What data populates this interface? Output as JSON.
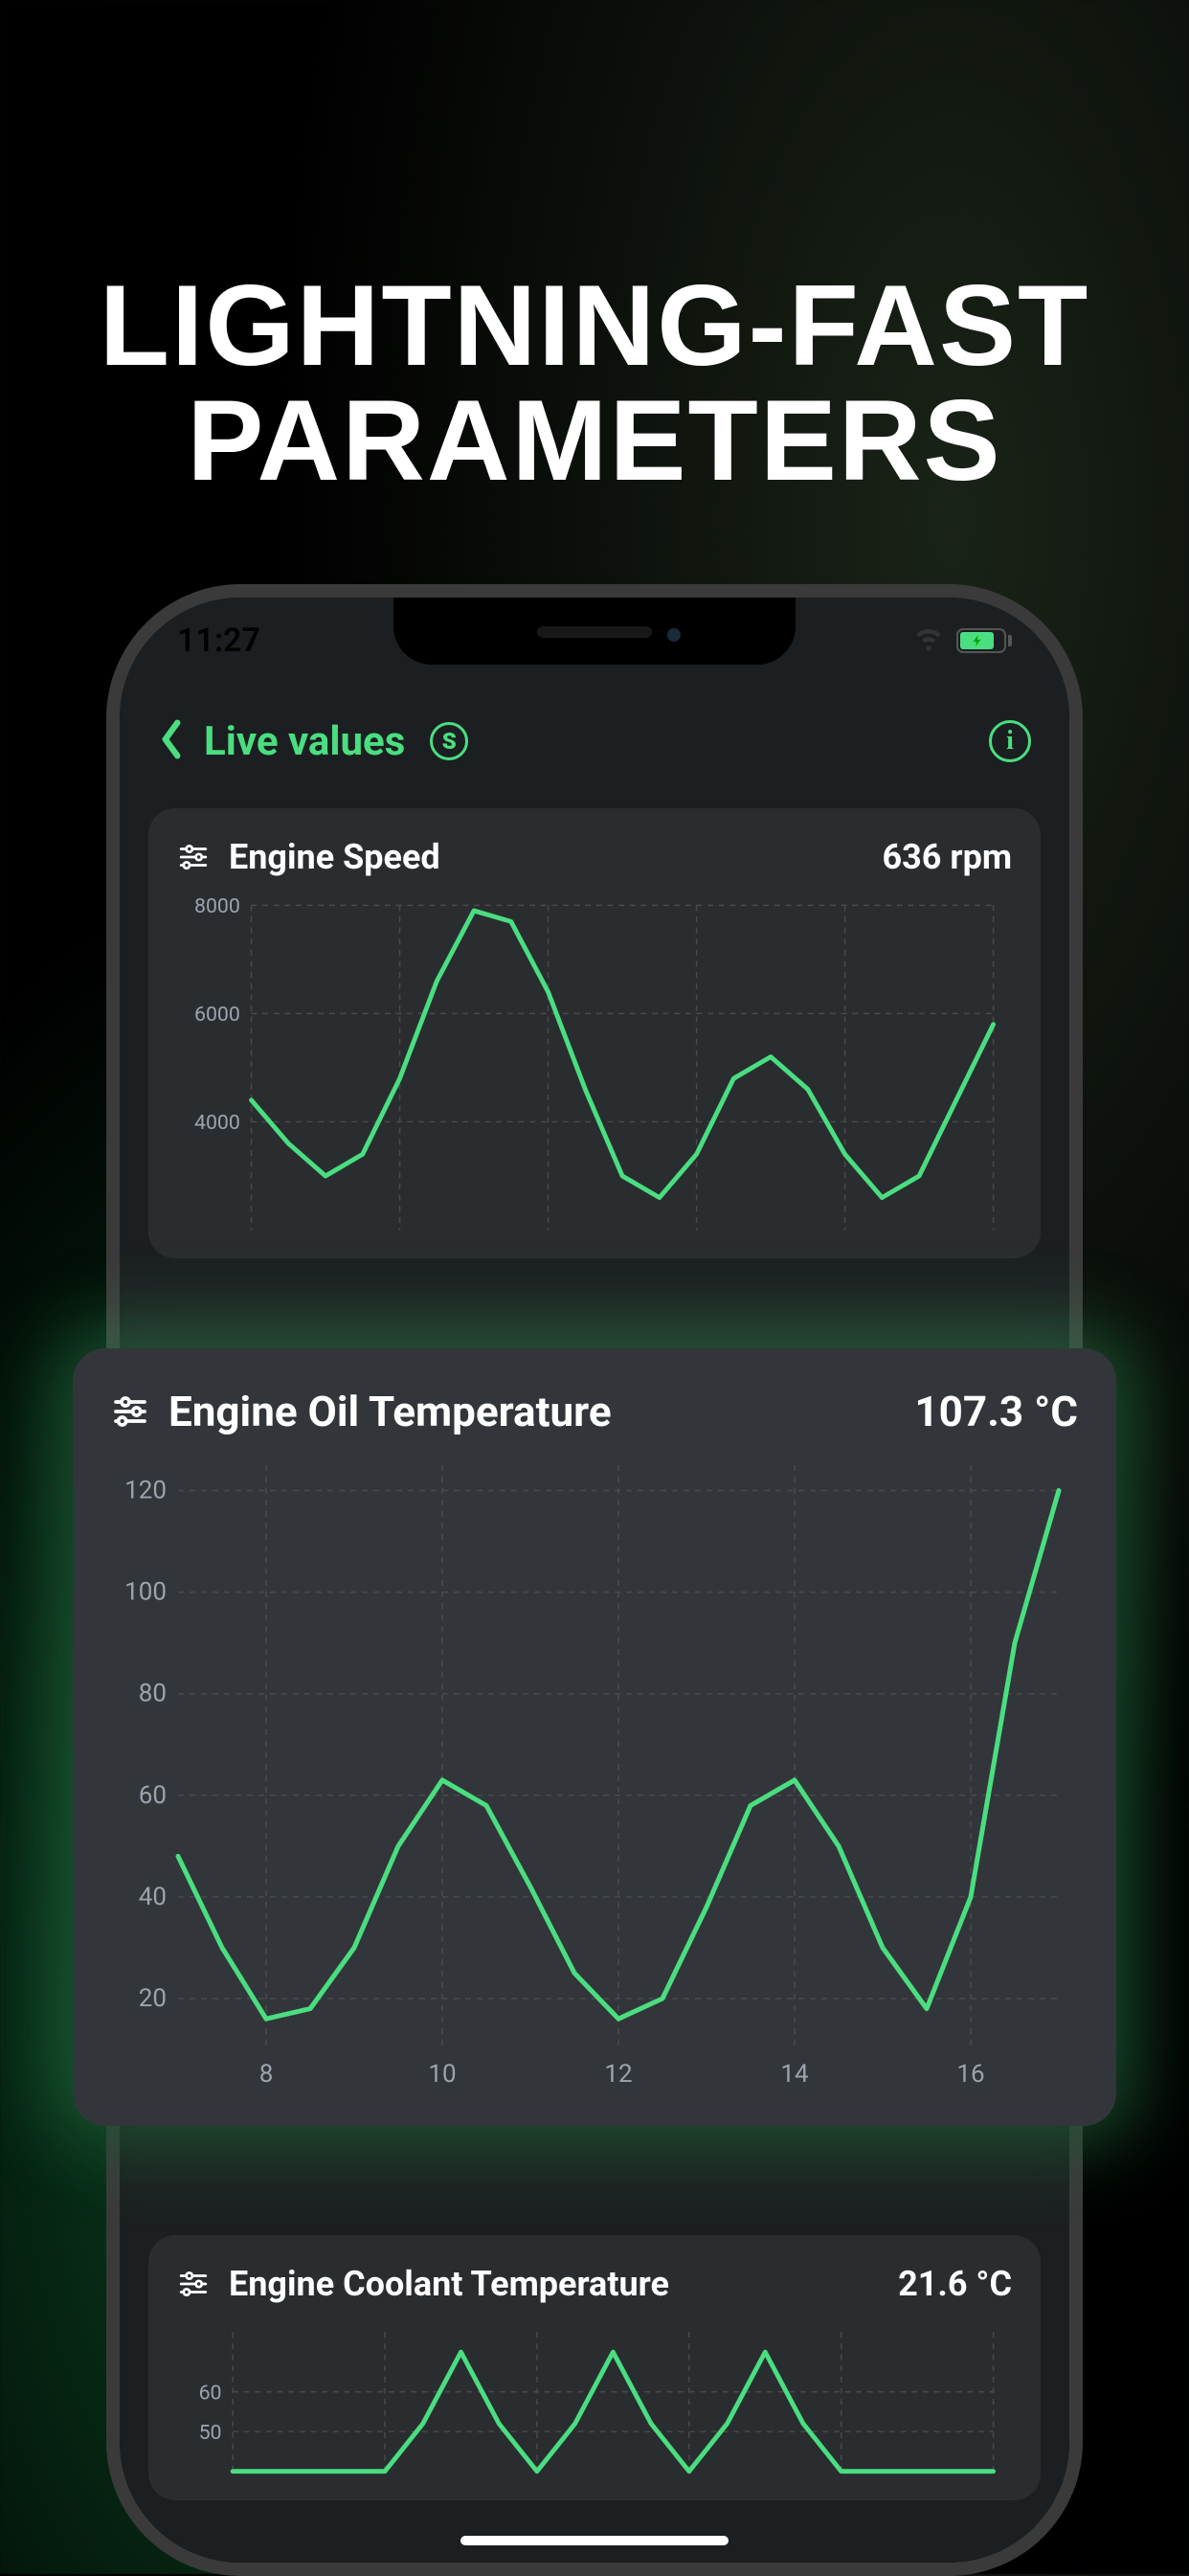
{
  "hero": {
    "line1": "LIGHTNING-FAST",
    "line2": "PARAMETERS"
  },
  "status_bar": {
    "time": "11:27"
  },
  "header": {
    "title": "Live values",
    "badge_letter": "S",
    "info_letter": "i"
  },
  "cards": [
    {
      "id": "engine_speed",
      "title": "Engine Speed",
      "value": "636 rpm"
    },
    {
      "id": "engine_oil_temp",
      "title": "Engine Oil Temperature",
      "value": "107.3 °C"
    },
    {
      "id": "engine_coolant_temp",
      "title": "Engine Coolant Temperature",
      "value": "21.6 °C"
    }
  ],
  "chart_data": [
    {
      "id": "engine_speed",
      "type": "line",
      "title": "Engine Speed",
      "ylabel": "rpm",
      "xlabel": "",
      "ylim": [
        2000,
        8000
      ],
      "y_ticks": [
        4000,
        6000,
        8000
      ],
      "x": [
        7,
        7.5,
        8,
        8.5,
        9,
        9.5,
        10,
        10.5,
        11,
        11.5,
        12,
        12.5,
        13,
        13.5,
        14,
        14.5,
        15,
        15.5,
        16,
        16.5,
        17
      ],
      "values": [
        4400,
        3600,
        3000,
        3400,
        4800,
        6600,
        7900,
        7700,
        6400,
        4600,
        3000,
        2600,
        3400,
        4800,
        5200,
        4600,
        3400,
        2600,
        3000,
        4400,
        5800
      ]
    },
    {
      "id": "engine_oil_temp",
      "type": "line",
      "title": "Engine Oil Temperature",
      "ylabel": "°C",
      "xlabel": "",
      "ylim": [
        10,
        125
      ],
      "y_ticks": [
        20,
        40,
        60,
        80,
        100,
        120
      ],
      "x_ticks": [
        8,
        10,
        12,
        14,
        16
      ],
      "x": [
        7,
        7.5,
        8,
        8.5,
        9,
        9.5,
        10,
        10.5,
        11,
        11.5,
        12,
        12.5,
        13,
        13.5,
        14,
        14.5,
        15,
        15.5,
        16,
        16.5,
        17
      ],
      "values": [
        48,
        30,
        16,
        18,
        30,
        50,
        63,
        58,
        42,
        25,
        16,
        20,
        38,
        58,
        63,
        50,
        30,
        18,
        40,
        90,
        120
      ]
    },
    {
      "id": "engine_coolant_temp",
      "type": "line",
      "title": "Engine Coolant Temperature",
      "ylabel": "°C",
      "xlabel": "",
      "ylim": [
        40,
        75
      ],
      "y_ticks": [
        50,
        60
      ],
      "x": [
        7,
        7.5,
        8,
        8.5,
        9,
        9.5,
        10,
        10.5,
        11,
        11.5,
        12,
        12.5,
        13,
        13.5,
        14,
        14.5,
        15,
        15.5,
        16,
        16.5,
        17
      ],
      "values": [
        40,
        40,
        40,
        40,
        40,
        52,
        70,
        52,
        40,
        52,
        70,
        52,
        40,
        52,
        70,
        52,
        40,
        40,
        40,
        40,
        40
      ]
    }
  ],
  "colors": {
    "accent": "#4ade80",
    "card_bg": "#2a2d30",
    "grid": "#4a4a4a"
  }
}
